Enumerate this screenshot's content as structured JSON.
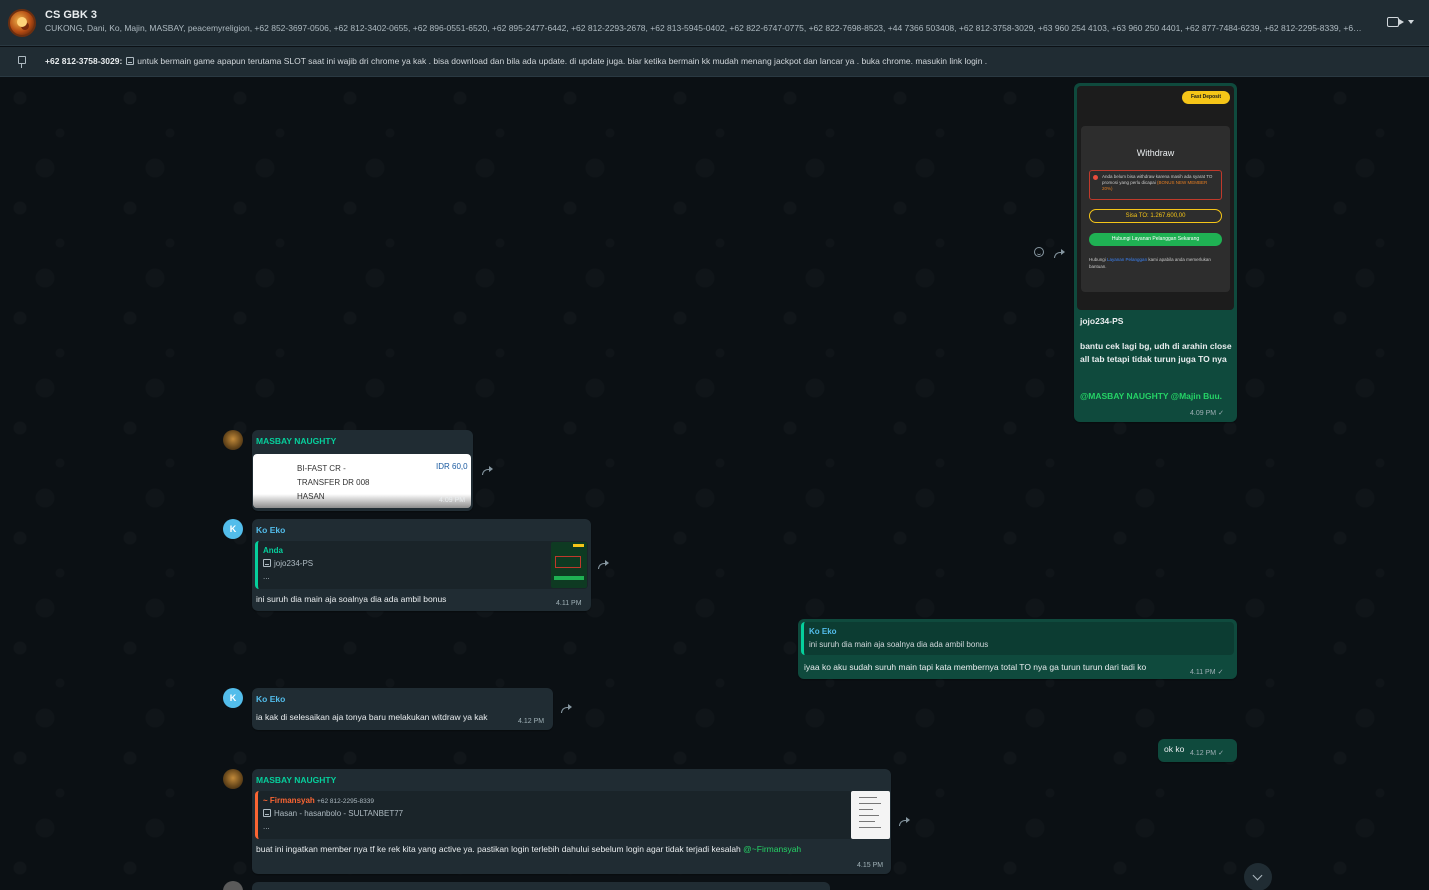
{
  "header": {
    "title": "CS GBK 3",
    "participants": "CUKONG, Dani, Ko, Majin, MASBAY, peacemyreligion, +62 852-3697-0506, +62 812-3402-0655, +62 896-0551-6520, +62 895-2477-6442, +62 812-2293-2678, +62 813-5945-0402, +62 822-6747-0775, +62 822-7698-8523, +44 7366 503408, +62 812-3758-3029, +63 960 254 4103, +63 960 250 4401, +62 877-7484-6239, +62 812-2295-8339, +62 ..."
  },
  "pinned": {
    "sender": "+62 812-3758-3029:",
    "text": "untuk bermain game apapun terutama SLOT saat ini wajib dri chrome ya kak . bisa download dan bila ada update. di update juga. biar ketika bermain  kk mudah menang jackpot dan lancar ya . buka chrome. masukin link login ."
  },
  "messages": {
    "m1": {
      "image": {
        "fast_deposit": "Fast Deposit",
        "title": "Withdraw",
        "warning": "Anda belum bisa withdraw karena masih ada syarat TO promosi yang perlu dicapai",
        "warning_bonus": "(BONUS NEW MEMBER 20%)",
        "sisa_to": "Sisa TO: 1.267.600,00",
        "contact_button": "Hubungi Layanan Pelanggan Sekarang",
        "note_pre": "Hubungi",
        "note_link": "Layanan Pelanggan",
        "note_post": "kami apabila anda memerlukan bantuan."
      },
      "caption_user": "jojo234-PS",
      "caption_text": "bantu cek lagi bg, udh di arahin close all tab tetapi tidak turun juga TO nya",
      "mentions": "@MASBAY NAUGHTY @Majin Buu.",
      "time": "4.09 PM",
      "tick": "✓"
    },
    "m2": {
      "sender": "MASBAY NAUGHTY",
      "receipt_desc": "BI-FAST CR -\nTRANSFER DR 008\nHASAN",
      "receipt_amount": "IDR 60,0",
      "time": "4.09 PM"
    },
    "m3": {
      "avatar_letter": "K",
      "sender": "Ko Eko",
      "quote_name": "Anda",
      "quote_text": "jojo234-PS",
      "quote_more": "...",
      "text": "ini suruh dia main aja soalnya dia ada ambil bonus",
      "time": "4.11 PM"
    },
    "m4": {
      "quote_name": "Ko Eko",
      "quote_text": "ini suruh dia main aja soalnya dia ada ambil bonus",
      "text": "iyaa ko aku sudah suruh main tapi kata membernya total TO nya ga turun turun dari tadi ko",
      "time": "4.11 PM",
      "tick": "✓"
    },
    "m5": {
      "avatar_letter": "K",
      "sender": "Ko Eko",
      "text": "ia kak di selesaikan aja tonya baru melakukan witdraw ya kak",
      "time": "4.12 PM"
    },
    "m6": {
      "text": "ok ko",
      "time": "4.12 PM",
      "tick": "✓"
    },
    "m7": {
      "sender": "MASBAY NAUGHTY",
      "quote_name": "~ Firmansyah",
      "quote_phone": "+62 812-2295-8339",
      "quote_text": "Hasan - hasanbolo - SULTANBET77",
      "quote_more": "...",
      "text": "buat ini ingatkan member nya tf ke rek kita yang active ya. pastikan login terlebih dahului sebelum login agar tidak terjadi kesalah",
      "mention": "@~Firmansyah",
      "time": "4.15 PM"
    }
  },
  "colors": {
    "incoming": "#202c33",
    "outgoing": "#0f4a3d",
    "masbay_name": "#06cf9c",
    "koeko_name": "#53bdeb",
    "firmansyah_name": "#fa6533",
    "mention": "#25d366"
  },
  "icons": [
    "group-avatar",
    "video-call-icon",
    "chevron-down-icon",
    "pin-icon",
    "document-icon",
    "emoji-icon",
    "forward-icon",
    "scroll-down-icon"
  ]
}
